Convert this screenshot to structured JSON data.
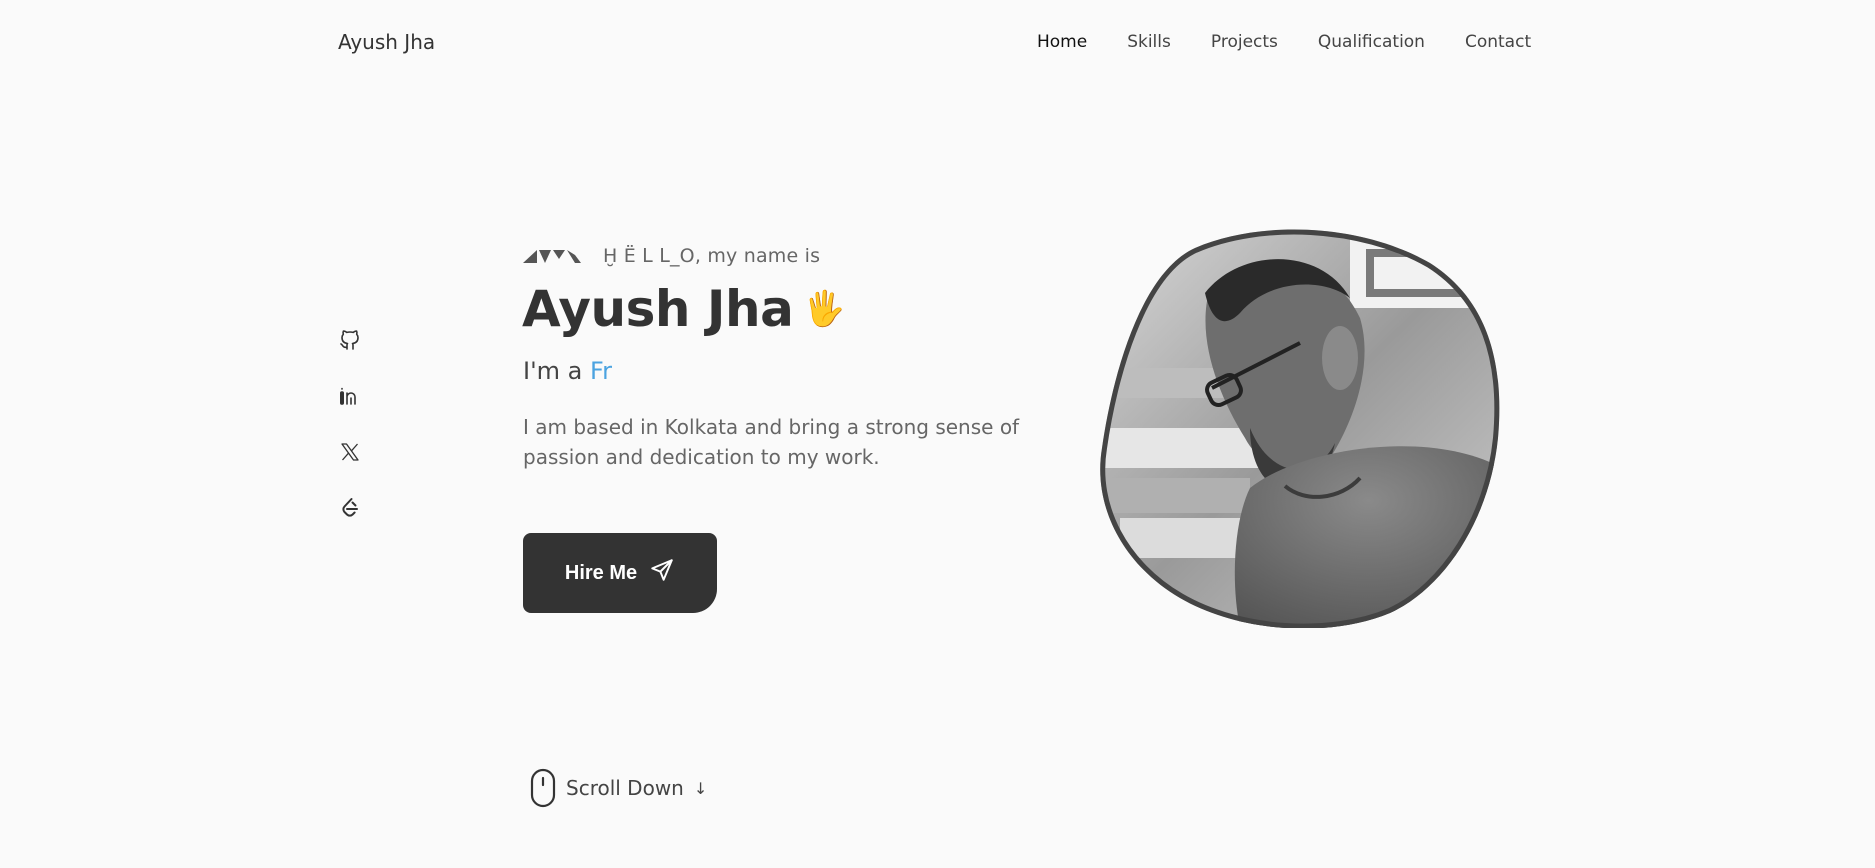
{
  "header": {
    "logo": "Ayush Jha",
    "nav": [
      {
        "label": "Home"
      },
      {
        "label": "Skills"
      },
      {
        "label": "Projects"
      },
      {
        "label": "Qualification"
      },
      {
        "label": "Contact"
      }
    ]
  },
  "social": {
    "icons": [
      "github-icon",
      "linkedin-icon",
      "x-twitter-icon",
      "leetcode-icon"
    ]
  },
  "hero": {
    "greeting": "Ḫ Ë ᒪ ᒪ_O, my name is",
    "name": "Ayush Jha",
    "wave_emoji": "🖐",
    "role_prefix": "I'm a ",
    "role_typed": "Fr",
    "description": "I am based in Kolkata and bring a strong sense of passion and dedication to my work.",
    "cta_label": "Hire Me"
  },
  "scroll": {
    "label": "Scroll Down",
    "arrow": "↓"
  },
  "colors": {
    "background": "#fafafa",
    "text": "#333333",
    "accent": "#4ba3e0",
    "button": "#333333"
  }
}
